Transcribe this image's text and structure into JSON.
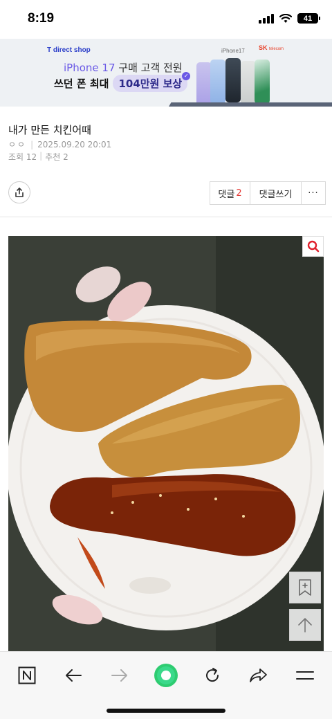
{
  "status_bar": {
    "time": "8:19",
    "battery": "41"
  },
  "ad": {
    "shop": "T direct shop",
    "line1_highlight": "iPhone 17",
    "line1_rest": " 구매 고객 전원",
    "line2_prefix": "쓰던 폰 최대",
    "line2_pill": "104만원 보상",
    "phone_label": "iPhone17",
    "sk_brand": "SK",
    "sk_sub": "telecom"
  },
  "post": {
    "title": "내가 만든 치킨어때",
    "author": "ㅇㅇ",
    "date": "2025.09.20 20:01",
    "views_label": "조회 12",
    "likes_label": "추천 2"
  },
  "actions": {
    "comments_label": "댓글",
    "comments_count": "2",
    "write_label": "댓글쓰기",
    "more_label": "···"
  },
  "icons": {
    "share": "share-icon",
    "zoom": "magnifier-icon",
    "bookmark": "bookmark-add-icon",
    "top": "arrow-up-icon",
    "home": "naver-n-icon",
    "back": "arrow-left-icon",
    "forward": "arrow-right-icon",
    "green": "green-circle-icon",
    "refresh": "refresh-icon",
    "share_nav": "share-arrow-icon",
    "menu": "menu-icon"
  },
  "colors": {
    "accent_red": "#e53935",
    "naver_green": "#2ecc71",
    "ad_purple": "#6a59e6"
  }
}
